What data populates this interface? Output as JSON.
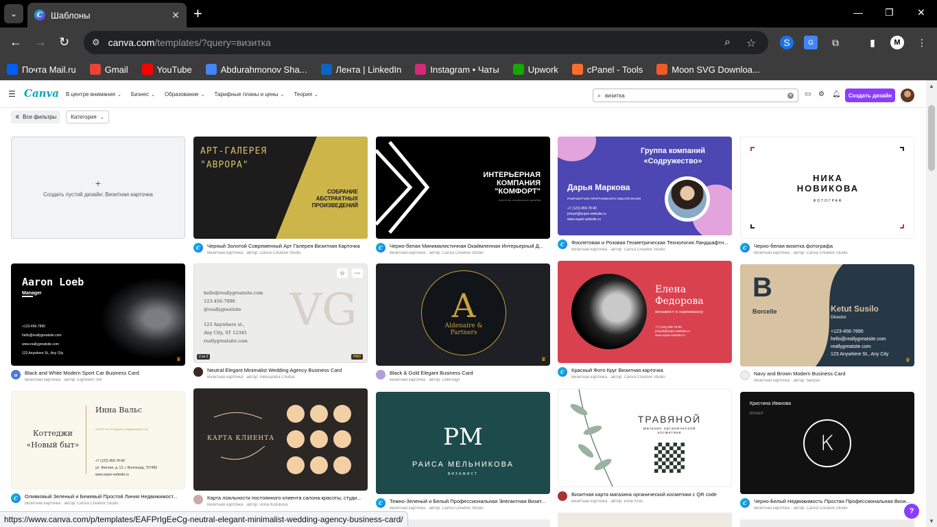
{
  "browser": {
    "tab_title": "Шаблоны",
    "url_host": "canva.com",
    "url_path": "/templates/?query=визитка",
    "bookmarks": [
      {
        "label": "Почта Mail.ru",
        "icon": "mail-ru-icon",
        "color": "#005ff9"
      },
      {
        "label": "Gmail",
        "icon": "gmail-icon",
        "color": "#ea4335"
      },
      {
        "label": "YouTube",
        "icon": "youtube-icon",
        "color": "#ff0000"
      },
      {
        "label": "Abdurahmonov Sha...",
        "icon": "docs-icon",
        "color": "#4285f4"
      },
      {
        "label": "Лента | LinkedIn",
        "icon": "linkedin-icon",
        "color": "#0a66c2"
      },
      {
        "label": "Instagram • Чаты",
        "icon": "instagram-icon",
        "color": "#d62976"
      },
      {
        "label": "Upwork",
        "icon": "upwork-icon",
        "color": "#14a800"
      },
      {
        "label": "cPanel - Tools",
        "icon": "cpanel-icon",
        "color": "#ff6c2c"
      },
      {
        "label": "Moon SVG Downloa...",
        "icon": "moon-svg-icon",
        "color": "#f05a28"
      }
    ],
    "status_url": "https://www.canva.com/p/templates/EAFPrIgEeCg-neutral-elegant-minimalist-wedding-agency-business-card/"
  },
  "canva": {
    "logo": "Canva",
    "nav": [
      "В центре внимания",
      "Бизнес",
      "Образование",
      "Тарифные планы и цены",
      "Теория"
    ],
    "search_value": "визитка",
    "create_button": "Создать дизайн",
    "filters": {
      "all": "Все фильтры",
      "category": "Категория"
    },
    "empty_card_label": "Создать пустой дизайн: Визитная карточка",
    "accent": "#8b3dff"
  },
  "cards": [
    {
      "title": "Черный Золотой Современный Арт Галерея Визитная Карточка",
      "sub": "Визитная карточка · автор: Canva Creative Studio",
      "t1": "АРТ-ГАЛЕРЕЯ",
      "t2": "\"АВРОРА\"",
      "t3": "СОБРАНИЕ АБСТРАКТНЫХ ПРОИЗВЕДЕНИЙ"
    },
    {
      "title": "Черно-белая Минималистичная Окаймленная Интерьерный Д...",
      "sub": "Визитная карточка · автор: Canva Creative Studio",
      "t1": "ИНТЕРЬЕРНАЯ КОМПАНИЯ \"КОМФОРТ\"",
      "t2": "Агентство интерьерного дизайна"
    },
    {
      "title": "Фиолетовая и Розовая Геометрическая Технология Ландшафтн...",
      "sub": "Визитная карточка · автор: Canva Creative Studio",
      "t1": "Группа компаний «Содружество»",
      "t2": "Дарья Маркова",
      "t3": "РАЗРАБОТЧИК ПРОГРАММНОГО ОБЕСПЕЧЕНИЯ",
      "t4": "+7 (123) 456-78-90",
      "t5": "privyet@super-website.ru",
      "t6": "www.super-website.ru"
    },
    {
      "title": "Черно-белая визитка фотографа",
      "sub": "Визитная карточка · автор: Canva Creative Studio",
      "t1": "НИКА НОВИКОВА",
      "t2": "ФОТОГРАФ"
    },
    {
      "title": "Black and White Modern Sport Car Business Card",
      "sub": "Визитная карточка · автор: Eightieen Std",
      "t1": "Aaron Loeb",
      "t2": "Manager",
      "t3": "+123-456-7890",
      "t4": "hello@reallygreatsite.com",
      "t5": "www.reallygreatsite.com",
      "t6": "123 Anywhere St., Any City"
    },
    {
      "title": "Neutral Elegant Minimalist Wedding Agency Business Card",
      "sub": "Визитная карточка · автор: Aleksandra Chubar",
      "t1": "hello@reallygreatsite.com",
      "t2": "123-456-7890",
      "t3": "@reallygreatsite",
      "t4": "123 Anywhere st.,",
      "t5": "Any City, ST 12345",
      "t6": "reallygreatsite.com",
      "badge": "2 из 2",
      "pro": "PRO"
    },
    {
      "title": "Black & Gold Elegant Business Card",
      "sub": "Визитная карточка · автор: LilienSign",
      "t1": "Aldenaire & Partners"
    },
    {
      "title": "Красный Фото Круг Визитная карточка",
      "sub": "Визитная карточка · автор: Canva Creative Studio",
      "t1": "Елена Федорова",
      "t2": "визажист и парикмахер",
      "t3": "+7 (123) 456-78-90",
      "t4": "privyet@super-website.ru",
      "t5": "www.super-website.ru"
    },
    {
      "title": "Navy and Brown Modern Business Card",
      "sub": "Визитная карточка · автор: hanyse",
      "t1": "Borcelle",
      "t2": "Ketut Susilo",
      "t3": "Director",
      "t4": "+123-456-7890",
      "t5": "hello@reallygreatsite.com",
      "t6": "reallygreatsite.com",
      "t7": "123 Anywhere St., Any City"
    },
    {
      "title": "Оливковый Зеленый и Бежевый Простой Линия Недвижимост...",
      "sub": "Визитная карточка · автор: Canva Creative Studio",
      "t1": "Коттеджи «Новый быт»",
      "t2": "Инна Вальс",
      "t3": "АГЕНТ ПО ПРОДАЖЕ НЕДВИЖИМОСТИ",
      "t4": "+7 (123) 456-78-90",
      "t5": "ул. Житная, д. 13, г. Волгоград, 757483",
      "t6": "www.super-website.ru"
    },
    {
      "title": "Карта лояльности постоянного клиента салона красоты, студи...",
      "sub": "Визитная карточка · автор: Anna Kutukova",
      "t1": "КАРТА КЛИЕНТА"
    },
    {
      "title": "Темно-Зеленый и Белый Профессиональная Элегантная Визит...",
      "sub": "Визитная карточка · автор: Canva Creative Studio",
      "t1": "РМ",
      "t2": "РАИСА МЕЛЬНИКОВА",
      "t3": "ВИЗАЖИСТ"
    },
    {
      "title": "Визитная карта магазина органической косметики с QR code",
      "sub": "Визитная карточка · автор: Irene Kras",
      "t1": "ТРАВЯНОЙ",
      "t2": "магазин органической косметики"
    },
    {
      "title": "Черно-Белый Недвижимость Простая Профессиональная Визи...",
      "sub": "Визитная карточка · автор: Canva Creative Studio",
      "t1": "Кристина Иванова",
      "t2": "БРОКЕР",
      "t3": "К"
    }
  ]
}
